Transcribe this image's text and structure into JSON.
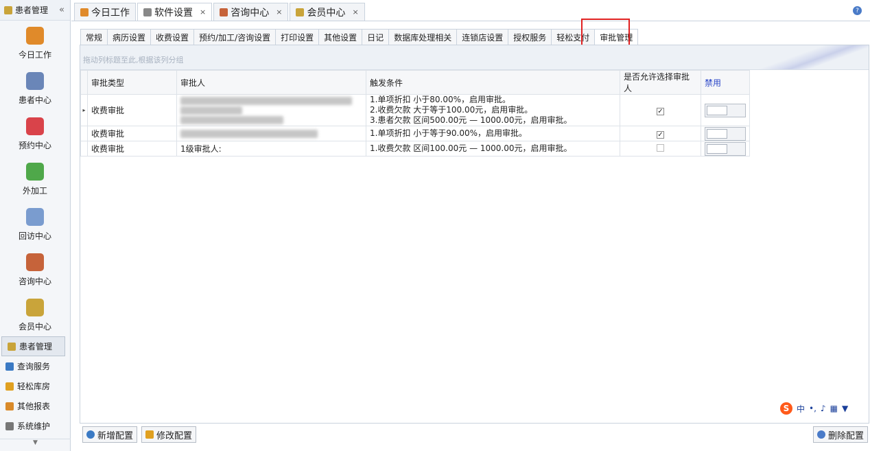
{
  "sidebar": {
    "header_title": "患者管理",
    "collapse_glyph": "«",
    "nav": [
      {
        "label": "今日工作",
        "icon": "worker-icon",
        "color": "#e08a2a"
      },
      {
        "label": "患者中心",
        "icon": "binoculars-icon",
        "color": "#6a86b8"
      },
      {
        "label": "预约中心",
        "icon": "calendar-icon",
        "color": "#d9434a"
      },
      {
        "label": "外加工",
        "icon": "cubes-icon",
        "color": "#4fa84a"
      },
      {
        "label": "回访中心",
        "icon": "refresh-icon",
        "color": "#7a9ccf"
      },
      {
        "label": "咨询中心",
        "icon": "consult-icon",
        "color": "#c6633a"
      },
      {
        "label": "会员中心",
        "icon": "members-icon",
        "color": "#c9a43a"
      }
    ],
    "list": [
      {
        "label": "患者管理",
        "icon": "patients-icon",
        "color": "#c9a43a"
      },
      {
        "label": "查询服务",
        "icon": "query-icon",
        "color": "#3b7ac4"
      },
      {
        "label": "轻松库房",
        "icon": "warehouse-icon",
        "color": "#e0a020"
      },
      {
        "label": "其他报表",
        "icon": "report-icon",
        "color": "#d98a2a"
      },
      {
        "label": "系统维护",
        "icon": "gear-icon",
        "color": "#777777"
      }
    ]
  },
  "top_tabs": [
    {
      "label": "今日工作",
      "closable": false
    },
    {
      "label": "软件设置",
      "closable": true
    },
    {
      "label": "咨询中心",
      "closable": true
    },
    {
      "label": "会员中心",
      "closable": true
    }
  ],
  "sub_tabs": [
    "常规",
    "病历设置",
    "收费设置",
    "预约/加工/咨询设置",
    "打印设置",
    "其他设置",
    "日记",
    "数据库处理相关",
    "连锁店设置",
    "授权服务",
    "轻松支付",
    "审批管理"
  ],
  "group_hint": "拖动列标题至此,根据该列分组",
  "table": {
    "headers": [
      "审批类型",
      "审批人",
      "触发条件",
      "是否允许选择审批人",
      "禁用"
    ],
    "rows": [
      {
        "type": "收费审批",
        "approver": "",
        "conditions": [
          "1.单项折扣 小于80.00%，启用审批。",
          "2.收费欠款 大于等于100.00元，启用审批。",
          "3.患者欠款 区间500.00元 — 1000.00元，启用审批。"
        ],
        "allow": true,
        "selected": true
      },
      {
        "type": "收费审批",
        "approver": "",
        "conditions": [
          "1.单项折扣 小于等于90.00%，启用审批。"
        ],
        "allow": true,
        "selected": false
      },
      {
        "type": "收费审批",
        "approver": "1级审批人:",
        "conditions": [
          "1.收费欠款 区间100.00元 — 1000.00元，启用审批。"
        ],
        "allow": false,
        "selected": false
      }
    ]
  },
  "buttons": {
    "add": "新增配置",
    "edit": "修改配置",
    "delete": "删除配置"
  },
  "ime": {
    "mode": "中",
    "punct": "•,"
  },
  "colors": {
    "highlight": "#e02020",
    "disable_header": "#2a46c8"
  }
}
